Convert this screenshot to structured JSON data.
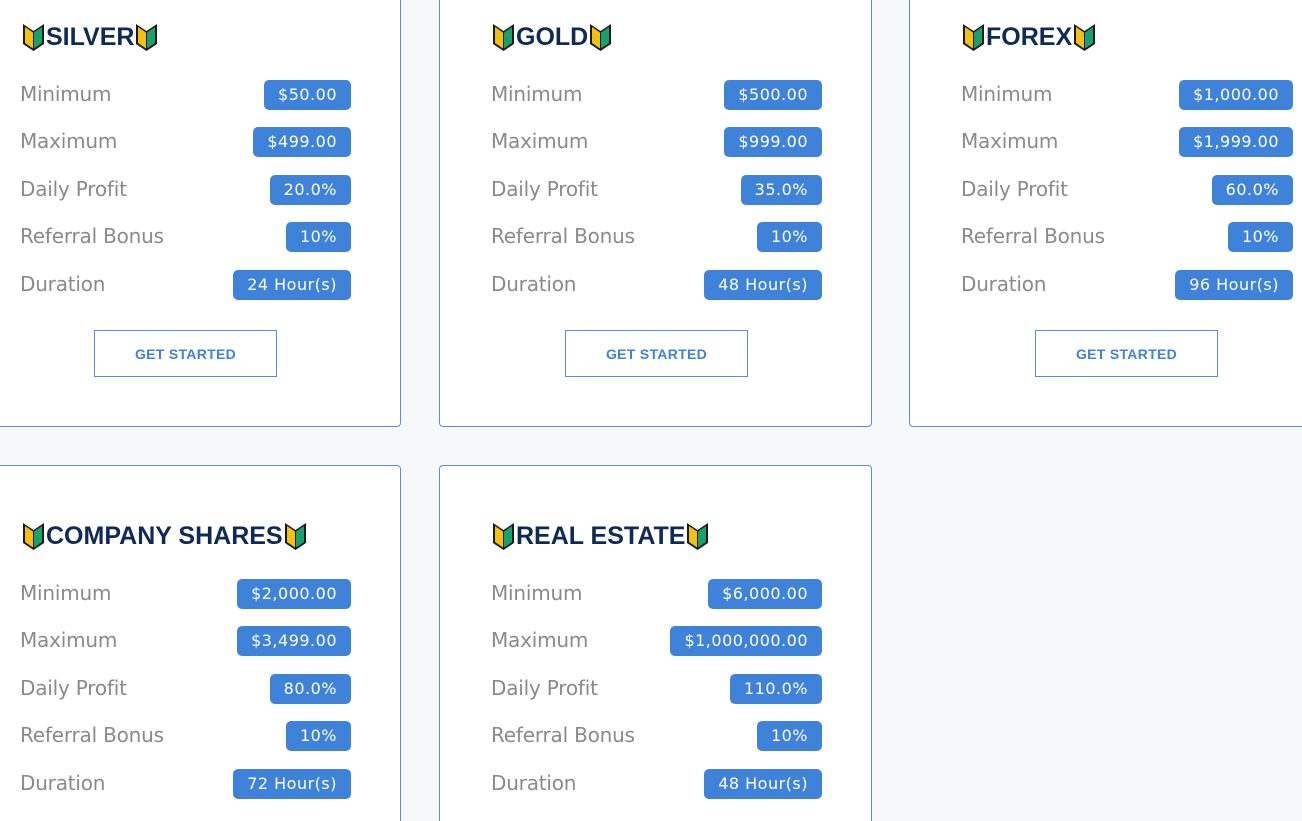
{
  "colors": {
    "accent": "#3f82d9",
    "title": "#0e2a57",
    "label": "#8a8a8a",
    "border": "#5b8fd0",
    "background": "#f7f8fa"
  },
  "labels": {
    "minimum": "Minimum",
    "maximum": "Maximum",
    "daily_profit": "Daily Profit",
    "referral_bonus": "Referral Bonus",
    "duration": "Duration"
  },
  "cta_label": "GET STARTED",
  "plans": [
    {
      "name": "SILVER",
      "icon": "beginner-shield-icon",
      "minimum": "$50.00",
      "maximum": "$499.00",
      "daily_profit": "20.0%",
      "referral_bonus": "10%",
      "duration": "24 Hour(s)"
    },
    {
      "name": "GOLD",
      "icon": "beginner-shield-icon",
      "minimum": "$500.00",
      "maximum": "$999.00",
      "daily_profit": "35.0%",
      "referral_bonus": "10%",
      "duration": "48 Hour(s)"
    },
    {
      "name": "FOREX",
      "icon": "beginner-shield-icon",
      "minimum": "$1,000.00",
      "maximum": "$1,999.00",
      "daily_profit": "60.0%",
      "referral_bonus": "10%",
      "duration": "96 Hour(s)"
    },
    {
      "name": "COMPANY SHARES",
      "icon": "beginner-shield-icon",
      "minimum": "$2,000.00",
      "maximum": "$3,499.00",
      "daily_profit": "80.0%",
      "referral_bonus": "10%",
      "duration": "72 Hour(s)"
    },
    {
      "name": "REAL ESTATE",
      "icon": "beginner-shield-icon",
      "minimum": "$6,000.00",
      "maximum": "$1,000,000.00",
      "daily_profit": "110.0%",
      "referral_bonus": "10%",
      "duration": "48 Hour(s)"
    }
  ]
}
